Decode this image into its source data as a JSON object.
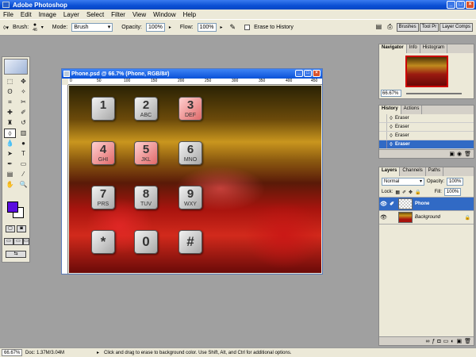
{
  "window": {
    "title": "Adobe Photoshop"
  },
  "menu": [
    "File",
    "Edit",
    "Image",
    "Layer",
    "Select",
    "Filter",
    "View",
    "Window",
    "Help"
  ],
  "options": {
    "brush_label": "Brush:",
    "brush_size": "46",
    "mode_label": "Mode:",
    "mode_value": "Brush",
    "opacity_label": "Opacity:",
    "opacity_value": "100%",
    "flow_label": "Flow:",
    "flow_value": "100%",
    "erase_history_label": "Erase to History"
  },
  "palette_well": [
    "Brushes",
    "Tool Pr",
    "Layer Comps"
  ],
  "document": {
    "title": "Phone.psd @ 66.7% (Phone, RGB/8#)",
    "ruler_ticks": [
      "0",
      "50",
      "100",
      "150",
      "200",
      "250",
      "300",
      "350",
      "400",
      "450"
    ],
    "keys": [
      {
        "num": "1",
        "letters": "",
        "style": "grey"
      },
      {
        "num": "2",
        "letters": "ABC",
        "style": "grey"
      },
      {
        "num": "3",
        "letters": "DEF",
        "style": "pink"
      },
      {
        "num": "4",
        "letters": "GHI",
        "style": "pink"
      },
      {
        "num": "5",
        "letters": "JKL",
        "style": "pink"
      },
      {
        "num": "6",
        "letters": "MNO",
        "style": "grey"
      },
      {
        "num": "7",
        "letters": "PRS",
        "style": "grey"
      },
      {
        "num": "8",
        "letters": "TUV",
        "style": "grey"
      },
      {
        "num": "9",
        "letters": "WXY",
        "style": "grey"
      },
      {
        "num": "*",
        "letters": "",
        "style": "grey"
      },
      {
        "num": "0",
        "letters": "",
        "style": "grey"
      },
      {
        "num": "#",
        "letters": "",
        "style": "grey"
      }
    ]
  },
  "navigator": {
    "tabs": [
      "Navigator",
      "Info",
      "Histogram"
    ],
    "zoom": "66.67%"
  },
  "history": {
    "tabs": [
      "History",
      "Actions"
    ],
    "items": [
      "Eraser",
      "Eraser",
      "Eraser",
      "Eraser"
    ]
  },
  "layers": {
    "tabs": [
      "Layers",
      "Channels",
      "Paths"
    ],
    "blend_mode": "Normal",
    "opacity_label": "Opacity:",
    "opacity_value": "100%",
    "lock_label": "Lock:",
    "fill_label": "Fill:",
    "fill_value": "100%",
    "items": [
      {
        "name": "Phone",
        "selected": true
      },
      {
        "name": "Background",
        "selected": false
      }
    ]
  },
  "status": {
    "zoom": "66.67%",
    "doc": "Doc: 1.37M/3.04M",
    "hint": "Click and drag to erase to background color.  Use Shift, Alt, and Ctrl for additional options."
  },
  "colors": {
    "foreground": "#5a0ce0",
    "background": "#ffffff",
    "selection": "#316ac5"
  }
}
